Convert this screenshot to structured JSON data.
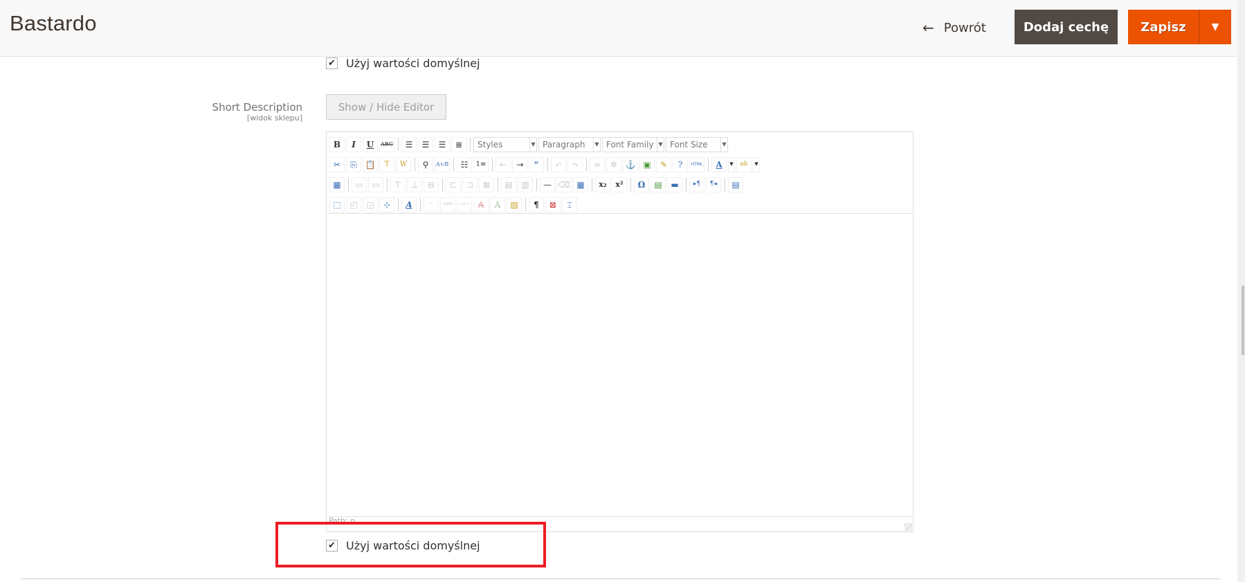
{
  "header": {
    "title": "Bastardo",
    "back_label": "Powrót",
    "add_attribute_label": "Dodaj cechę",
    "save_label": "Zapisz",
    "colors": {
      "save": "#eb5202",
      "add_attribute": "#514943"
    }
  },
  "top_use_default": {
    "label": "Użyj wartości domyślnej",
    "checked": true
  },
  "short_description": {
    "label": "Short Description",
    "scope": "[widok sklepu]",
    "toggle_editor_label": "Show / Hide Editor",
    "editor": {
      "toolbar": {
        "row1": [
          "bold",
          "italic",
          "underline",
          "strikethrough",
          "|",
          "align-left",
          "align-center",
          "align-right",
          "align-justify",
          "|"
        ],
        "selects": {
          "styles": "Styles",
          "paragraph": "Paragraph",
          "font_family": "Font Family",
          "font_size": "Font Size"
        },
        "row2": [
          "cut",
          "copy",
          "paste",
          "paste-text",
          "paste-word",
          "|",
          "find",
          "replace",
          "|",
          "bullet-list",
          "numbered-list",
          "|",
          "outdent",
          "indent",
          "blockquote",
          "|",
          "undo",
          "redo",
          "|",
          "link",
          "unlink",
          "anchor",
          "image",
          "cleanup",
          "help",
          "html",
          "|",
          "text-color",
          "background-color"
        ],
        "row3": [
          "insert-table",
          "|",
          "row-props",
          "cell-props",
          "|",
          "insert-row-before",
          "insert-row-after",
          "delete-row",
          "|",
          "insert-col-before",
          "insert-col-after",
          "delete-col",
          "|",
          "split-cells",
          "merge-cells",
          "|",
          "horizontal-rule",
          "remove-format",
          "visual-aid",
          "|",
          "subscript",
          "superscript",
          "|",
          "special-char",
          "media",
          "advanced-hr",
          "|",
          "ltr",
          "rtl",
          "|",
          "fullscreen"
        ],
        "row4": [
          "insert-layer",
          "move-forward",
          "move-backward",
          "absolute",
          "|",
          "styleprops",
          "|",
          "cite",
          "abbr",
          "acronym",
          "del",
          "ins",
          "attribs",
          "|",
          "visualchars",
          "nonbreaking",
          "pagebreak"
        ]
      },
      "content": "",
      "path": "Path: p"
    }
  },
  "bottom_use_default": {
    "label": "Użyj wartości domyślnej",
    "checked": true,
    "highlighted": true
  }
}
